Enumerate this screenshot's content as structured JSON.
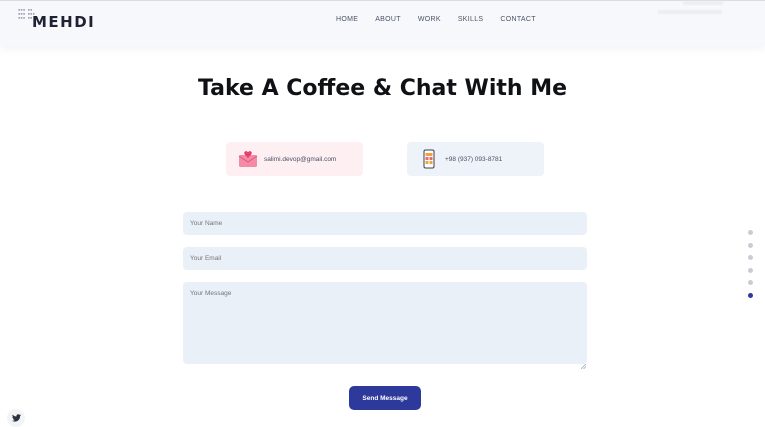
{
  "header": {
    "logo": "MEHDI",
    "logo_mark": "ᗑᗑ ᗑᗑ\nᗑᗑᗑ ᗑᗑᗑ\nᗑᗑᗑ ᗑᗑᗑ",
    "nav": [
      "HOME",
      "ABOUT",
      "WORK",
      "SKILLS",
      "CONTACT"
    ]
  },
  "main": {
    "title": "Take A Coffee & Chat With Me",
    "email_card": {
      "text": "salimi.devop@gmail.com",
      "icon": "envelope-heart-icon"
    },
    "phone_card": {
      "text": "+98 (937) 093-8781",
      "icon": "smartphone-icon"
    }
  },
  "form": {
    "name_placeholder": "Your Name",
    "email_placeholder": "Your Email",
    "message_placeholder": "Your Message",
    "send_label": "Send Message"
  },
  "side_nav": {
    "count": 6,
    "active_index": 5
  },
  "social": {
    "icon": "twitter-icon"
  },
  "colors": {
    "accent": "#2e3a9b",
    "field_bg": "#eaf0f8",
    "email_card_bg": "#fdeff2",
    "phone_card_bg": "#eef2f9"
  }
}
